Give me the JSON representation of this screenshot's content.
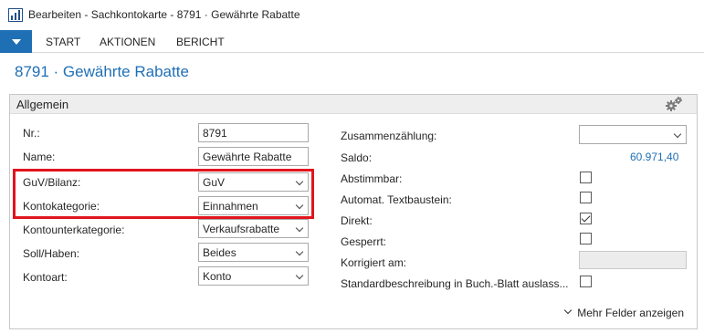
{
  "window": {
    "title": "Bearbeiten - Sachkontokarte - 8791 · Gewährte Rabatte"
  },
  "ribbon": {
    "tabs": [
      "START",
      "AKTIONEN",
      "BERICHT"
    ]
  },
  "page": {
    "title": "8791 · Gewährte Rabatte"
  },
  "fasttab": {
    "title": "Allgemein",
    "left": {
      "nr": {
        "label": "Nr.:",
        "value": "8791"
      },
      "name": {
        "label": "Name:",
        "value": "Gewährte Rabatte"
      },
      "guv_bilanz": {
        "label": "GuV/Bilanz:",
        "value": "GuV"
      },
      "kontokategorie": {
        "label": "Kontokategorie:",
        "value": "Einnahmen"
      },
      "kontounterkategorie": {
        "label": "Kontounterkategorie:",
        "value": "Verkaufsrabatte"
      },
      "soll_haben": {
        "label": "Soll/Haben:",
        "value": "Beides"
      },
      "kontoart": {
        "label": "Kontoart:",
        "value": "Konto"
      }
    },
    "right": {
      "zusammenzaehlung": {
        "label": "Zusammenzählung:",
        "value": ""
      },
      "saldo": {
        "label": "Saldo:",
        "value": "60.971,40"
      },
      "abstimmbar": {
        "label": "Abstimmbar:",
        "checked": false
      },
      "automat_textbaustein": {
        "label": "Automat. Textbaustein:",
        "checked": false
      },
      "direkt": {
        "label": "Direkt:",
        "checked": true
      },
      "gesperrt": {
        "label": "Gesperrt:",
        "checked": false
      },
      "korrigiert_am": {
        "label": "Korrigiert am:",
        "value": ""
      },
      "standardbeschreibung": {
        "label": "Standardbeschreibung in Buch.-Blatt auslass...",
        "checked": false
      }
    },
    "more_fields": "Mehr Felder anzeigen"
  },
  "colors": {
    "accent": "#1f6fb5",
    "highlight": "#e1141e"
  },
  "icons": {
    "app": "chart-icon",
    "ribbon_toggle": "caret-down-icon",
    "personalize": "gears-icon",
    "more": "chevron-down-icon"
  }
}
